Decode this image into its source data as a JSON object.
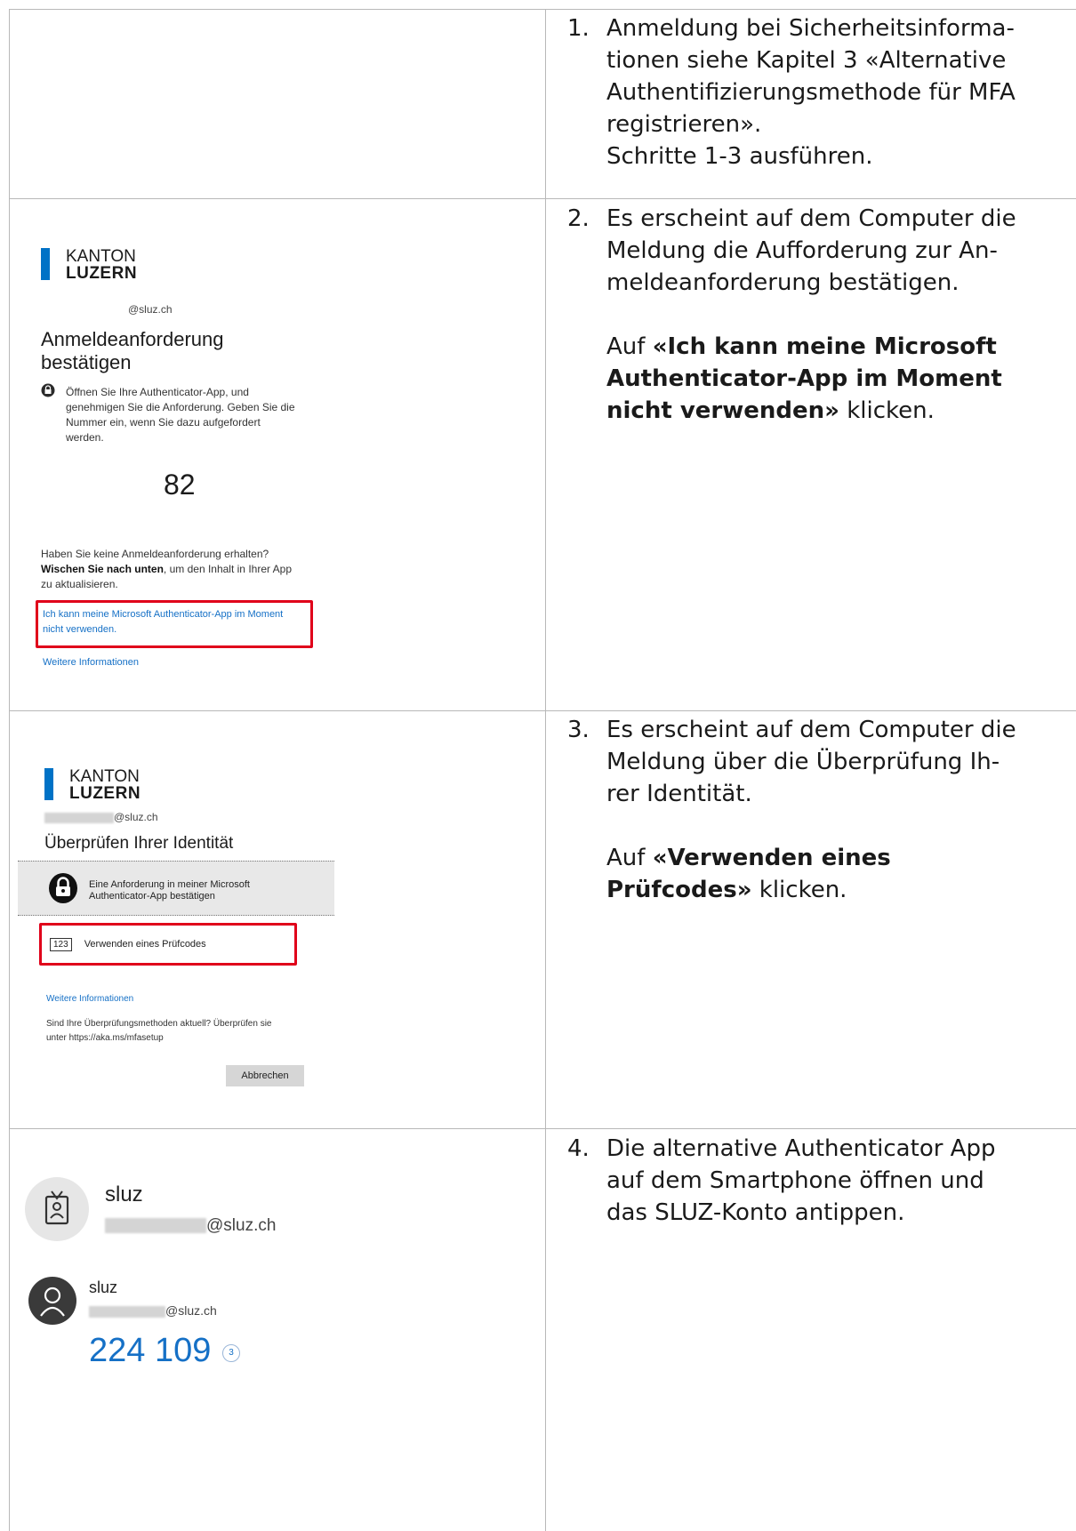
{
  "steps": [
    {
      "number": "1.",
      "lines": [
        "Anmeldung bei Sicherheitsinforma-",
        "tionen siehe Kapitel 3 «Alternative",
        "Authentifizierungsmethode für MFA",
        "registrieren».",
        "Schritte 1-3 ausführen."
      ]
    },
    {
      "number": "2.",
      "lines": [
        "Es erscheint auf dem Computer die",
        "Meldung die Aufforderung zur An-",
        "meldeanforderung bestätigen."
      ],
      "action_prefix": "Auf ",
      "action_bold_lines": [
        "«Ich kann meine Microsoft",
        "Authenticator-App im Moment",
        "nicht verwenden»"
      ],
      "action_suffix": " klicken."
    },
    {
      "number": "3.",
      "lines": [
        "Es erscheint auf dem Computer die",
        "Meldung über die Überprüfung Ih-",
        "rer Identität."
      ],
      "action_prefix": "Auf ",
      "action_bold_lines": [
        "«Verwenden eines",
        "Prüfcodes»"
      ],
      "action_suffix": " klicken."
    },
    {
      "number": "4.",
      "lines": [
        "Die alternative Authenticator App",
        "auf dem Smartphone öffnen und",
        "das SLUZ-Konto antippen."
      ]
    }
  ],
  "shot2": {
    "logo_line1": "KANTON",
    "logo_line2": "LUZERN",
    "email": "@sluz.ch",
    "title_line1": "Anmeldeanforderung",
    "title_line2": "bestätigen",
    "instruction_lines": [
      "Öffnen Sie Ihre Authenticator-App, und",
      "genehmigen Sie die Anforderung. Geben Sie die",
      "Nummer ein, wenn Sie dazu aufgefordert",
      "werden."
    ],
    "number": "82",
    "no_request": "Haben Sie keine Anmeldeanforderung erhalten?",
    "swipe_bold": "Wischen Sie nach unten",
    "swipe_rest1": ", um den Inhalt in Ihrer App",
    "swipe_rest2": "zu aktualisieren.",
    "cannot_use_line1": "Ich kann meine Microsoft Authenticator-App im Moment",
    "cannot_use_line2": "nicht verwenden.",
    "more_info": "Weitere Informationen",
    "accent": "#0072c6",
    "highlight": "#e0001a"
  },
  "shot3": {
    "logo_line1": "KANTON",
    "logo_line2": "LUZERN",
    "email": "@sluz.ch",
    "title": "Überprüfen Ihrer Identität",
    "option1_line1": "Eine Anforderung in meiner Microsoft",
    "option1_line2": "Authenticator-App bestätigen",
    "option2_icon_text": "123",
    "option2": "Verwenden eines Prüfcodes",
    "more_info": "Weitere Informationen",
    "methods_line1": "Sind Ihre Überprüfungsmethoden aktuell? Überprüfen sie",
    "methods_line2": "unter https://aka.ms/mfasetup",
    "cancel": "Abbrechen"
  },
  "shot4": {
    "account1_name": "sluz",
    "account1_email": "@sluz.ch",
    "account2_name": "sluz",
    "account2_email": "@sluz.ch",
    "code": "224 109",
    "timer": "3",
    "code_color": "#1570c6"
  }
}
